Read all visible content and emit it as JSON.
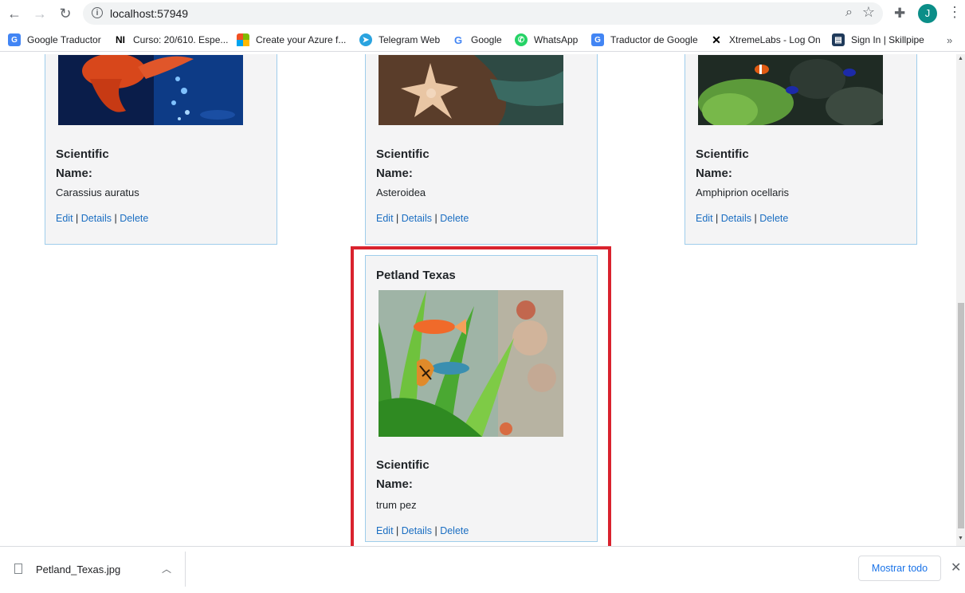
{
  "browser": {
    "url": "localhost:57949",
    "avatar_letter": "J",
    "bookmarks": [
      {
        "label": "Google Traductor",
        "icon": "google-translate-icon"
      },
      {
        "label": "Curso: 20/610. Espe...",
        "icon": "ni-icon"
      },
      {
        "label": "Create your Azure f...",
        "icon": "microsoft-icon"
      },
      {
        "label": "Telegram Web",
        "icon": "telegram-icon"
      },
      {
        "label": "Google",
        "icon": "google-icon"
      },
      {
        "label": "WhatsApp",
        "icon": "whatsapp-icon"
      },
      {
        "label": "Traductor de Google",
        "icon": "google-translate-icon"
      },
      {
        "label": "XtremeLabs - Log On",
        "icon": "xtremelabs-icon"
      },
      {
        "label": "Sign In | Skillpipe",
        "icon": "skillpipe-icon"
      }
    ],
    "more_glyph": "»"
  },
  "cards": [
    {
      "scientific_label_1": "Scientific",
      "scientific_label_2": "Name:",
      "scientific_name": "Carassius auratus",
      "edit": "Edit",
      "details": "Details",
      "delete": "Delete",
      "sep": "|"
    },
    {
      "scientific_label_1": "Scientific",
      "scientific_label_2": "Name:",
      "scientific_name": "Asteroidea",
      "edit": "Edit",
      "details": "Details",
      "delete": "Delete",
      "sep": "|"
    },
    {
      "scientific_label_1": "Scientific",
      "scientific_label_2": "Name:",
      "scientific_name": "Amphiprion ocellaris",
      "edit": "Edit",
      "details": "Details",
      "delete": "Delete",
      "sep": "|"
    },
    {
      "title": "Petland Texas",
      "scientific_label_1": "Scientific",
      "scientific_label_2": "Name:",
      "scientific_name": "trum pez",
      "edit": "Edit",
      "details": "Details",
      "delete": "Delete",
      "sep": "|"
    }
  ],
  "downloads": {
    "file_name": "Petland_Texas.jpg",
    "show_all": "Mostrar todo"
  },
  "colors": {
    "link": "#1b6ec2",
    "card_border": "#9fcdeb",
    "highlight": "#d9232e",
    "avatar": "#0b8e88"
  }
}
